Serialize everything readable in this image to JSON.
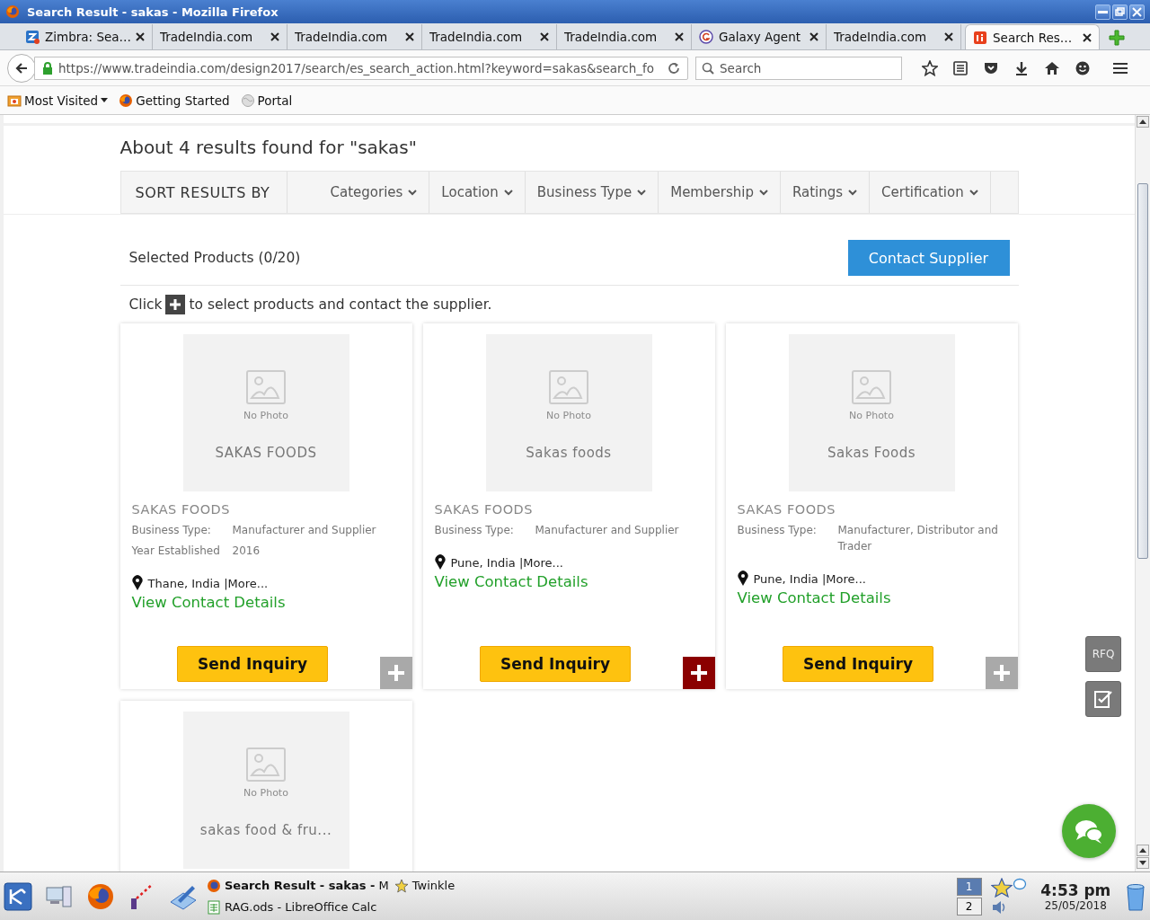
{
  "window": {
    "title": "Search Result - sakas - Mozilla Firefox"
  },
  "tabs": [
    {
      "label": "Zimbra: Sea…",
      "selected": false
    },
    {
      "label": "TradeIndia.com",
      "selected": false
    },
    {
      "label": "TradeIndia.com",
      "selected": false
    },
    {
      "label": "TradeIndia.com",
      "selected": false
    },
    {
      "label": "TradeIndia.com",
      "selected": false
    },
    {
      "label": "Galaxy Agent",
      "selected": false
    },
    {
      "label": "TradeIndia.com",
      "selected": false
    },
    {
      "label": "Search Res…",
      "selected": true
    }
  ],
  "toolbar": {
    "url": "https://www.tradeindia.com/design2017/search/es_search_action.html?keyword=sakas&search_fo",
    "search": {
      "placeholder": "Search"
    }
  },
  "bookmarks": [
    {
      "label": "Most Visited",
      "kind": "folder"
    },
    {
      "label": "Getting Started",
      "kind": "firefox"
    },
    {
      "label": "Portal",
      "kind": "globe"
    }
  ],
  "page": {
    "heading": "About 4 results found for \"sakas\"",
    "sort_label": "SORT RESULTS BY",
    "filters": [
      "Categories",
      "Location",
      "Business Type",
      "Membership",
      "Ratings",
      "Certification"
    ],
    "selected_products": "Selected Products (0/20)",
    "contact_button": "Contact Supplier",
    "hint_prefix": "Click",
    "hint_text": "to select products and contact the supplier.",
    "cards": [
      {
        "photo_caption": "No Photo",
        "photo_title": "SAKAS FOODS",
        "company": "SAKAS FOODS",
        "details": [
          {
            "label": "Business Type:",
            "value": "Manufacturer and Supplier"
          },
          {
            "label": "Year Established",
            "value": "2016"
          }
        ],
        "location": "Thane, India |More...",
        "link": "View Contact Details",
        "button": "Send Inquiry",
        "selected": false
      },
      {
        "photo_caption": "No Photo",
        "photo_title": "Sakas foods",
        "company": "SAKAS FOODS",
        "details": [
          {
            "label": "Business Type:",
            "value": "Manufacturer and Supplier"
          }
        ],
        "location": "Pune, India |More...",
        "link": "View Contact Details",
        "button": "Send Inquiry",
        "selected": true
      },
      {
        "photo_caption": "No Photo",
        "photo_title": "Sakas Foods",
        "company": "SAKAS FOODS",
        "details": [
          {
            "label": "Business Type:",
            "value": "Manufacturer, Distributor and Trader"
          }
        ],
        "location": "Pune, India |More...",
        "link": "View Contact Details",
        "button": "Send Inquiry",
        "selected": false
      },
      {
        "photo_caption": "No Photo",
        "photo_title": "sakas food & fru..."
      }
    ],
    "rfq_button": "RFQ"
  },
  "taskbar": {
    "tasks": [
      {
        "label": "**Search Result - sakas -** M"
      },
      {
        "label": "RAG.ods - LibreOffice Calc"
      },
      {
        "label": "Twinkle"
      }
    ],
    "desktops": [
      {
        "label": "1",
        "selected": true
      },
      {
        "label": "2",
        "selected": false
      }
    ],
    "time": "4:53 pm",
    "date": "25/05/2018"
  }
}
